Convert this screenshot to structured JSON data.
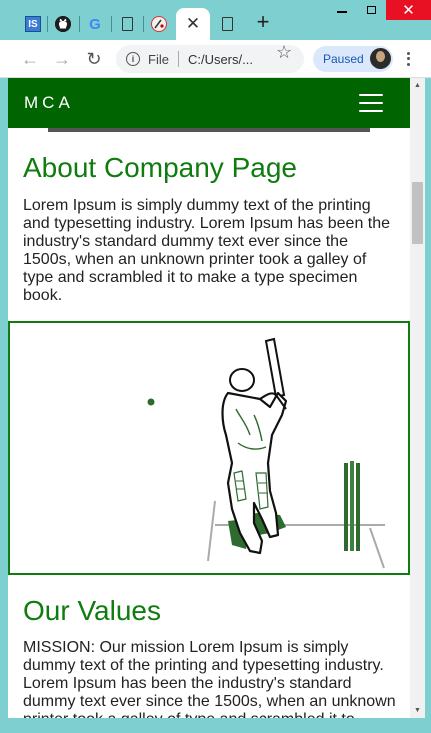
{
  "browser": {
    "tabs": [
      {
        "icon": "is-icon",
        "label": "IS"
      },
      {
        "icon": "github-icon"
      },
      {
        "icon": "google-icon",
        "label": "G"
      },
      {
        "icon": "document-icon"
      },
      {
        "icon": "cricket-icon"
      },
      {
        "icon": "close-icon",
        "label": "✕"
      },
      {
        "icon": "document-icon"
      }
    ],
    "new_tab_label": "+",
    "window_controls": {
      "close_label": "✕"
    },
    "toolbar": {
      "back_label": "←",
      "forward_label": "→",
      "reload_label": "↻",
      "info_label": "i",
      "scheme_label": "File",
      "url": "C:/Users/...",
      "star_label": "☆",
      "profile_status": "Paused"
    },
    "colors": {
      "frame": "#7ecfcf",
      "close": "#e81123",
      "paused_bg": "#dbe8fb"
    }
  },
  "site": {
    "brand": "MCA",
    "colors": {
      "navbar": "#006400",
      "heading": "#107c10"
    },
    "about": {
      "title": "About Company Page",
      "body": "Lorem Ipsum is simply dummy text of the printing and typesetting industry. Lorem Ipsum has been the industry's standard dummy text ever since the 1500s, when an unknown printer took a galley of type and scrambled it to make a type specimen book."
    },
    "values": {
      "title": "Our Values",
      "body": "MISSION: Our mission Lorem Ipsum is simply dummy text of the printing and typesetting industry. Lorem Ipsum has been the industry's standard dummy text ever since the 1500s, when an unknown printer took a galley of type and scrambled it to make a type specimen book."
    }
  }
}
